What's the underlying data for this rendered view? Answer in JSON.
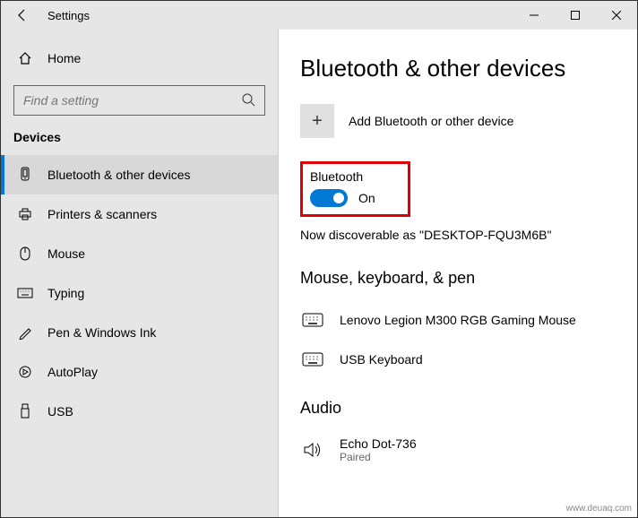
{
  "window": {
    "title": "Settings"
  },
  "sidebar": {
    "home": "Home",
    "search_placeholder": "Find a setting",
    "group": "Devices",
    "items": [
      {
        "label": "Bluetooth & other devices"
      },
      {
        "label": "Printers & scanners"
      },
      {
        "label": "Mouse"
      },
      {
        "label": "Typing"
      },
      {
        "label": "Pen & Windows Ink"
      },
      {
        "label": "AutoPlay"
      },
      {
        "label": "USB"
      }
    ]
  },
  "main": {
    "heading": "Bluetooth & other devices",
    "add_label": "Add Bluetooth or other device",
    "bt_label": "Bluetooth",
    "bt_state": "On",
    "discoverable": "Now discoverable as \"DESKTOP-FQU3M6B\"",
    "section1": "Mouse, keyboard, & pen",
    "devices1": [
      {
        "name": "Lenovo Legion M300 RGB Gaming Mouse"
      },
      {
        "name": "USB Keyboard"
      }
    ],
    "section2": "Audio",
    "devices2": [
      {
        "name": "Echo Dot-736",
        "status": "Paired"
      }
    ]
  },
  "watermark": "www.deuaq.com"
}
